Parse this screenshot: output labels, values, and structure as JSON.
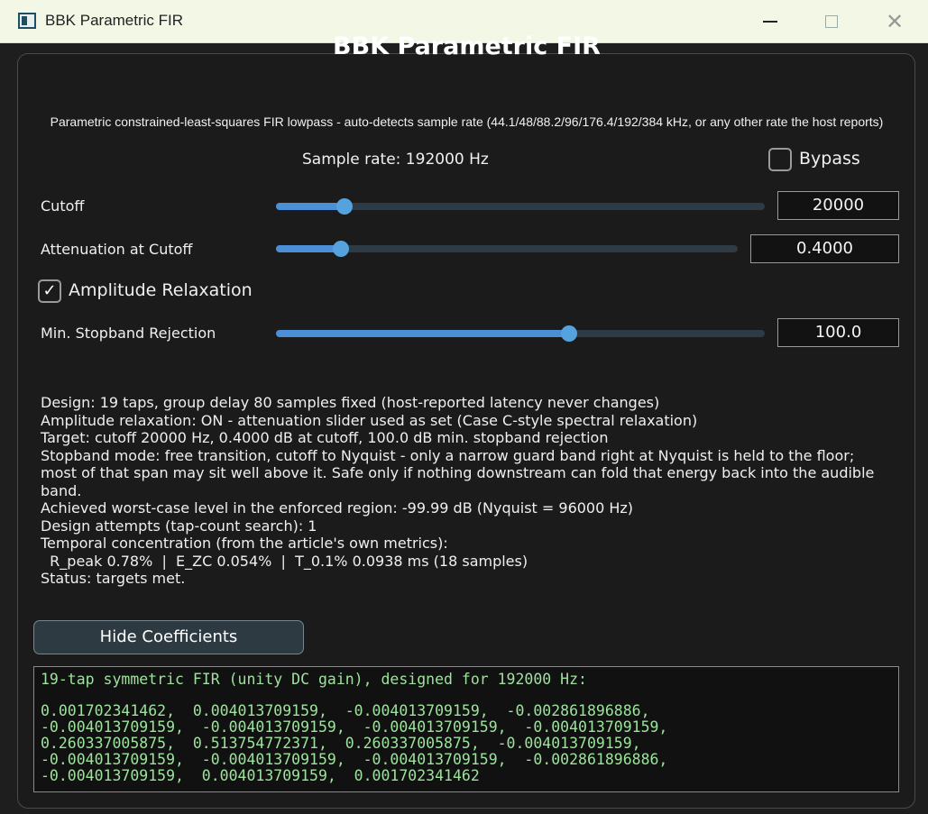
{
  "window": {
    "title": "BBK Parametric FIR"
  },
  "header": {
    "title": "BBK Parametric FIR",
    "subtitle": "Parametric constrained-least-squares FIR lowpass - auto-detects sample rate (44.1/48/88.2/96/176.4/192/384 kHz, or any other rate the host reports)",
    "sample_rate": "Sample rate: 192000 Hz"
  },
  "bypass": {
    "label": "Bypass",
    "checked": false
  },
  "params": {
    "cutoff": {
      "label": "Cutoff",
      "value": "20000",
      "level": 0.14
    },
    "attenuation": {
      "label": "Attenuation at Cutoff",
      "value": "0.4000",
      "level": 0.14
    },
    "relaxation": {
      "label": "Amplitude Relaxation",
      "checked": true,
      "check_glyph": "✓"
    },
    "stopband": {
      "label": "Min. Stopband Rejection",
      "value": "100.0",
      "level": 0.6
    }
  },
  "report": {
    "lines": [
      "Design: 19 taps, group delay 80 samples fixed (host-reported latency never changes)",
      "Amplitude relaxation: ON - attenuation slider used as set (Case C-style spectral relaxation)",
      "Target: cutoff 20000 Hz, 0.4000 dB at cutoff, 100.0 dB min. stopband rejection",
      "Stopband mode: free transition, cutoff to Nyquist - only a narrow guard band right at Nyquist is held to the floor;",
      "most of that span may sit well above it. Safe only if nothing downstream can fold that energy back into the audible",
      "band.",
      "Achieved worst-case level in the enforced region: -99.99 dB (Nyquist = 96000 Hz)",
      "Design attempts (tap-count search): 1",
      "Temporal concentration (from the article's own metrics):",
      "  R_peak 0.78%  |  E_ZC 0.054%  |  T_0.1% 0.0938 ms (18 samples)",
      "Status: targets met."
    ]
  },
  "coefficients": {
    "button_label": "Hide Coefficients",
    "header": "19-tap symmetric FIR (unity DC gain), designed for 192000 Hz:",
    "lines": [
      "0.001702341462,  0.004013709159,  -0.004013709159,  -0.002861896886,",
      "-0.004013709159,  -0.004013709159,  -0.004013709159,  -0.004013709159,",
      "0.260337005875,  0.513754772371,  0.260337005875,  -0.004013709159,",
      "-0.004013709159,  -0.004013709159,  -0.004013709159,  -0.002861896886,",
      "-0.004013709159,  0.004013709159,  0.001702341462"
    ]
  },
  "colors": {
    "accent": "#4d8fd6",
    "thumb": "#55a3de",
    "coef_text": "#9de39d"
  }
}
